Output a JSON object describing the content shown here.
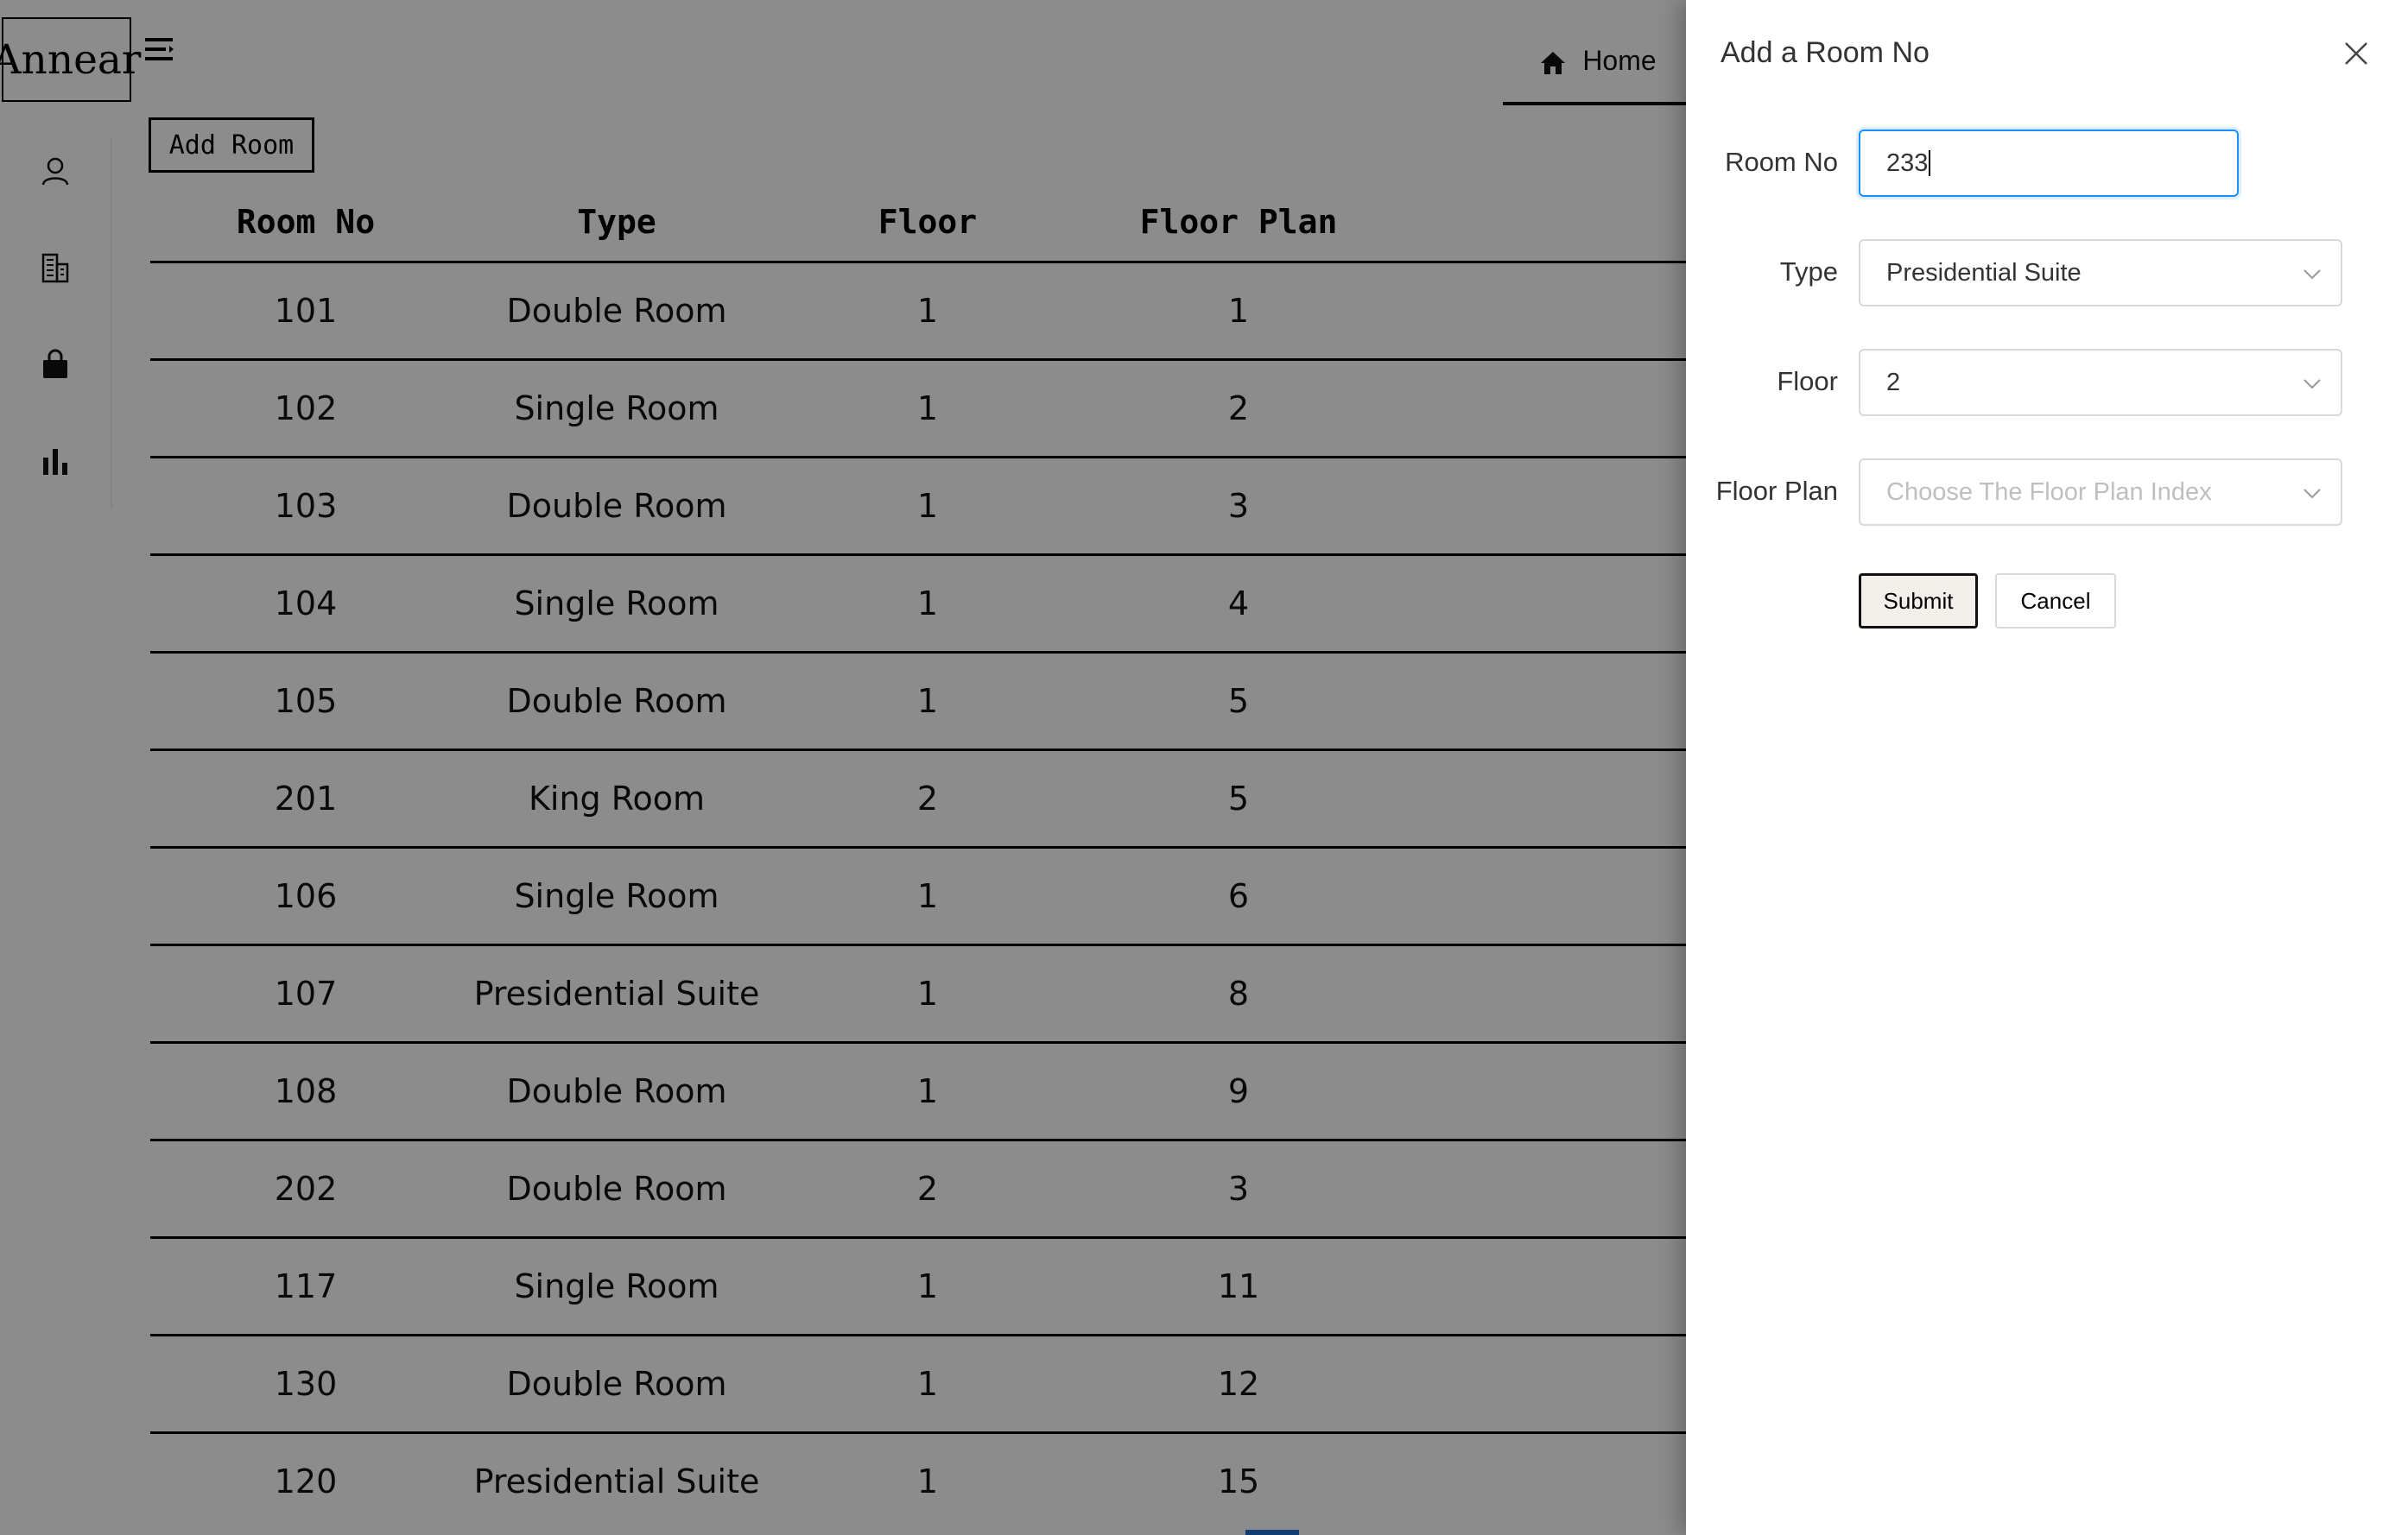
{
  "app": {
    "logo_text": "Annear"
  },
  "header": {
    "tab_home": "Home"
  },
  "toolbar": {
    "add_room_label": "Add Room"
  },
  "table": {
    "headers": [
      "Room No",
      "Type",
      "Floor",
      "Floor Plan"
    ],
    "rows": [
      [
        "101",
        "Double Room",
        "1",
        "1"
      ],
      [
        "102",
        "Single Room",
        "1",
        "2"
      ],
      [
        "103",
        "Double Room",
        "1",
        "3"
      ],
      [
        "104",
        "Single Room",
        "1",
        "4"
      ],
      [
        "105",
        "Double Room",
        "1",
        "5"
      ],
      [
        "201",
        "King Room",
        "2",
        "5"
      ],
      [
        "106",
        "Single Room",
        "1",
        "6"
      ],
      [
        "107",
        "Presidential Suite",
        "1",
        "8"
      ],
      [
        "108",
        "Double Room",
        "1",
        "9"
      ],
      [
        "202",
        "Double Room",
        "2",
        "3"
      ],
      [
        "117",
        "Single Room",
        "1",
        "11"
      ],
      [
        "130",
        "Double Room",
        "1",
        "12"
      ],
      [
        "120",
        "Presidential Suite",
        "1",
        "15"
      ]
    ]
  },
  "icons": {
    "menu": "menu-fold-icon",
    "home": "home-icon",
    "sidebar": [
      "user-icon",
      "building-icon",
      "shopping-bag-icon",
      "bar-chart-icon"
    ],
    "close": "close-icon",
    "select": "chevron-down-icon"
  },
  "drawer": {
    "title": "Add a Room No",
    "fields": {
      "room_no": {
        "label": "Room No",
        "value": "233"
      },
      "type": {
        "label": "Type",
        "value": "Presidential Suite"
      },
      "floor": {
        "label": "Floor",
        "value": "2"
      },
      "floor_plan": {
        "label": "Floor Plan",
        "value": "",
        "placeholder": "Choose The Floor Plan Index"
      }
    },
    "submit_label": "Submit",
    "cancel_label": "Cancel"
  },
  "colors": {
    "overlay": "rgba(0,0,0,0.45)",
    "focus_border": "#1890ff",
    "pagination_accent": "#1f6fd1"
  }
}
